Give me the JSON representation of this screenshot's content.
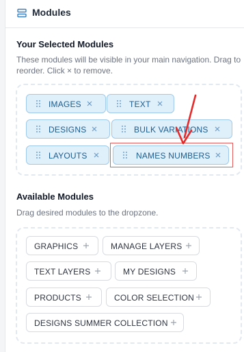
{
  "header": {
    "title": "Modules",
    "icon": "layers-icon"
  },
  "selected": {
    "title": "Your Selected Modules",
    "description": "These modules will be visible in your main navigation. Drag to reorder. Click × to remove.",
    "items": [
      {
        "label": "IMAGES"
      },
      {
        "label": "TEXT"
      },
      {
        "label": "DESIGNS"
      },
      {
        "label": "BULK VARIATIONS"
      },
      {
        "label": "LAYOUTS"
      },
      {
        "label": "NAMES NUMBERS"
      }
    ]
  },
  "available": {
    "title": "Available Modules",
    "description": "Drag desired modules to the dropzone.",
    "items": [
      {
        "label": "GRAPHICS"
      },
      {
        "label": "MANAGE LAYERS"
      },
      {
        "label": "TEXT LAYERS"
      },
      {
        "label": "MY DESIGNS"
      },
      {
        "label": "PRODUCTS"
      },
      {
        "label": "COLOR SELECTION"
      },
      {
        "label": "DESIGNS SUMMER COLLECTION"
      }
    ]
  },
  "colors": {
    "selected_chip_bg": "#e0f0fb",
    "selected_chip_text": "#1b5b8e",
    "annotation_red": "#e42b2b"
  }
}
